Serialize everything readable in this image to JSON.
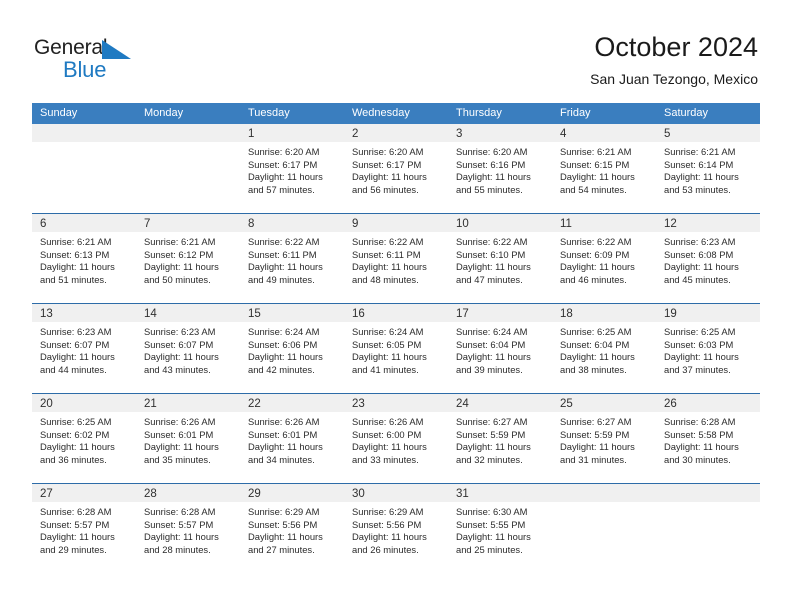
{
  "logo": {
    "text_primary": "General",
    "text_secondary": "Blue",
    "icon": "triangle-icon",
    "color_primary": "#222222",
    "color_secondary": "#1f7ac2"
  },
  "header": {
    "title": "October 2024",
    "subtitle": "San Juan Tezongo, Mexico"
  },
  "colors": {
    "header_band": "#3a7ebf",
    "week_divider": "#2d6ca8",
    "daynum_band": "#f0f0f0",
    "text": "#2b2b2b"
  },
  "weekdays": [
    "Sunday",
    "Monday",
    "Tuesday",
    "Wednesday",
    "Thursday",
    "Friday",
    "Saturday"
  ],
  "weeks": [
    [
      {
        "day": "",
        "sunrise": "",
        "sunset": "",
        "daylight1": "",
        "daylight2": "",
        "empty": true
      },
      {
        "day": "",
        "sunrise": "",
        "sunset": "",
        "daylight1": "",
        "daylight2": "",
        "empty": true
      },
      {
        "day": "1",
        "sunrise": "Sunrise: 6:20 AM",
        "sunset": "Sunset: 6:17 PM",
        "daylight1": "Daylight: 11 hours",
        "daylight2": "and 57 minutes."
      },
      {
        "day": "2",
        "sunrise": "Sunrise: 6:20 AM",
        "sunset": "Sunset: 6:17 PM",
        "daylight1": "Daylight: 11 hours",
        "daylight2": "and 56 minutes."
      },
      {
        "day": "3",
        "sunrise": "Sunrise: 6:20 AM",
        "sunset": "Sunset: 6:16 PM",
        "daylight1": "Daylight: 11 hours",
        "daylight2": "and 55 minutes."
      },
      {
        "day": "4",
        "sunrise": "Sunrise: 6:21 AM",
        "sunset": "Sunset: 6:15 PM",
        "daylight1": "Daylight: 11 hours",
        "daylight2": "and 54 minutes."
      },
      {
        "day": "5",
        "sunrise": "Sunrise: 6:21 AM",
        "sunset": "Sunset: 6:14 PM",
        "daylight1": "Daylight: 11 hours",
        "daylight2": "and 53 minutes."
      }
    ],
    [
      {
        "day": "6",
        "sunrise": "Sunrise: 6:21 AM",
        "sunset": "Sunset: 6:13 PM",
        "daylight1": "Daylight: 11 hours",
        "daylight2": "and 51 minutes."
      },
      {
        "day": "7",
        "sunrise": "Sunrise: 6:21 AM",
        "sunset": "Sunset: 6:12 PM",
        "daylight1": "Daylight: 11 hours",
        "daylight2": "and 50 minutes."
      },
      {
        "day": "8",
        "sunrise": "Sunrise: 6:22 AM",
        "sunset": "Sunset: 6:11 PM",
        "daylight1": "Daylight: 11 hours",
        "daylight2": "and 49 minutes."
      },
      {
        "day": "9",
        "sunrise": "Sunrise: 6:22 AM",
        "sunset": "Sunset: 6:11 PM",
        "daylight1": "Daylight: 11 hours",
        "daylight2": "and 48 minutes."
      },
      {
        "day": "10",
        "sunrise": "Sunrise: 6:22 AM",
        "sunset": "Sunset: 6:10 PM",
        "daylight1": "Daylight: 11 hours",
        "daylight2": "and 47 minutes."
      },
      {
        "day": "11",
        "sunrise": "Sunrise: 6:22 AM",
        "sunset": "Sunset: 6:09 PM",
        "daylight1": "Daylight: 11 hours",
        "daylight2": "and 46 minutes."
      },
      {
        "day": "12",
        "sunrise": "Sunrise: 6:23 AM",
        "sunset": "Sunset: 6:08 PM",
        "daylight1": "Daylight: 11 hours",
        "daylight2": "and 45 minutes."
      }
    ],
    [
      {
        "day": "13",
        "sunrise": "Sunrise: 6:23 AM",
        "sunset": "Sunset: 6:07 PM",
        "daylight1": "Daylight: 11 hours",
        "daylight2": "and 44 minutes."
      },
      {
        "day": "14",
        "sunrise": "Sunrise: 6:23 AM",
        "sunset": "Sunset: 6:07 PM",
        "daylight1": "Daylight: 11 hours",
        "daylight2": "and 43 minutes."
      },
      {
        "day": "15",
        "sunrise": "Sunrise: 6:24 AM",
        "sunset": "Sunset: 6:06 PM",
        "daylight1": "Daylight: 11 hours",
        "daylight2": "and 42 minutes."
      },
      {
        "day": "16",
        "sunrise": "Sunrise: 6:24 AM",
        "sunset": "Sunset: 6:05 PM",
        "daylight1": "Daylight: 11 hours",
        "daylight2": "and 41 minutes."
      },
      {
        "day": "17",
        "sunrise": "Sunrise: 6:24 AM",
        "sunset": "Sunset: 6:04 PM",
        "daylight1": "Daylight: 11 hours",
        "daylight2": "and 39 minutes."
      },
      {
        "day": "18",
        "sunrise": "Sunrise: 6:25 AM",
        "sunset": "Sunset: 6:04 PM",
        "daylight1": "Daylight: 11 hours",
        "daylight2": "and 38 minutes."
      },
      {
        "day": "19",
        "sunrise": "Sunrise: 6:25 AM",
        "sunset": "Sunset: 6:03 PM",
        "daylight1": "Daylight: 11 hours",
        "daylight2": "and 37 minutes."
      }
    ],
    [
      {
        "day": "20",
        "sunrise": "Sunrise: 6:25 AM",
        "sunset": "Sunset: 6:02 PM",
        "daylight1": "Daylight: 11 hours",
        "daylight2": "and 36 minutes."
      },
      {
        "day": "21",
        "sunrise": "Sunrise: 6:26 AM",
        "sunset": "Sunset: 6:01 PM",
        "daylight1": "Daylight: 11 hours",
        "daylight2": "and 35 minutes."
      },
      {
        "day": "22",
        "sunrise": "Sunrise: 6:26 AM",
        "sunset": "Sunset: 6:01 PM",
        "daylight1": "Daylight: 11 hours",
        "daylight2": "and 34 minutes."
      },
      {
        "day": "23",
        "sunrise": "Sunrise: 6:26 AM",
        "sunset": "Sunset: 6:00 PM",
        "daylight1": "Daylight: 11 hours",
        "daylight2": "and 33 minutes."
      },
      {
        "day": "24",
        "sunrise": "Sunrise: 6:27 AM",
        "sunset": "Sunset: 5:59 PM",
        "daylight1": "Daylight: 11 hours",
        "daylight2": "and 32 minutes."
      },
      {
        "day": "25",
        "sunrise": "Sunrise: 6:27 AM",
        "sunset": "Sunset: 5:59 PM",
        "daylight1": "Daylight: 11 hours",
        "daylight2": "and 31 minutes."
      },
      {
        "day": "26",
        "sunrise": "Sunrise: 6:28 AM",
        "sunset": "Sunset: 5:58 PM",
        "daylight1": "Daylight: 11 hours",
        "daylight2": "and 30 minutes."
      }
    ],
    [
      {
        "day": "27",
        "sunrise": "Sunrise: 6:28 AM",
        "sunset": "Sunset: 5:57 PM",
        "daylight1": "Daylight: 11 hours",
        "daylight2": "and 29 minutes."
      },
      {
        "day": "28",
        "sunrise": "Sunrise: 6:28 AM",
        "sunset": "Sunset: 5:57 PM",
        "daylight1": "Daylight: 11 hours",
        "daylight2": "and 28 minutes."
      },
      {
        "day": "29",
        "sunrise": "Sunrise: 6:29 AM",
        "sunset": "Sunset: 5:56 PM",
        "daylight1": "Daylight: 11 hours",
        "daylight2": "and 27 minutes."
      },
      {
        "day": "30",
        "sunrise": "Sunrise: 6:29 AM",
        "sunset": "Sunset: 5:56 PM",
        "daylight1": "Daylight: 11 hours",
        "daylight2": "and 26 minutes."
      },
      {
        "day": "31",
        "sunrise": "Sunrise: 6:30 AM",
        "sunset": "Sunset: 5:55 PM",
        "daylight1": "Daylight: 11 hours",
        "daylight2": "and 25 minutes."
      },
      {
        "day": "",
        "sunrise": "",
        "sunset": "",
        "daylight1": "",
        "daylight2": "",
        "empty": true
      },
      {
        "day": "",
        "sunrise": "",
        "sunset": "",
        "daylight1": "",
        "daylight2": "",
        "empty": true
      }
    ]
  ]
}
